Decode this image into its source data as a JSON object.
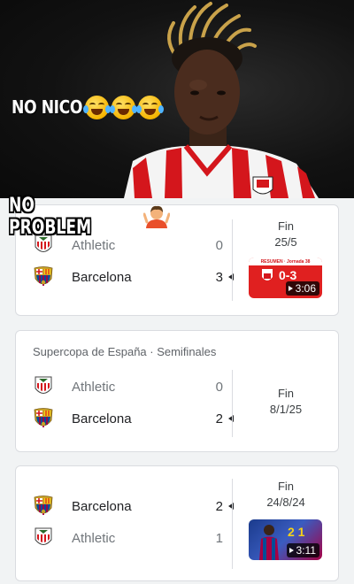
{
  "meme": {
    "top_text": "NO NICO",
    "bottom_text": "NO PROBLEM",
    "top_emojis": [
      "laughing-crying-emoji",
      "laughing-crying-emoji",
      "laughing-crying-emoji"
    ],
    "bottom_emoji": "shrug-emoji"
  },
  "matches": [
    {
      "competition": "",
      "status": "Fin",
      "date": "25/5",
      "teams": [
        {
          "name": "Athletic",
          "score": "0",
          "crest": "athletic-club-crest-icon",
          "winner": false
        },
        {
          "name": "Barcelona",
          "score": "3",
          "crest": "fc-barcelona-crest-icon",
          "winner": true
        }
      ],
      "video": {
        "duration": "3:06",
        "thumb_caption": "RESUMEN · Jornada 38",
        "thumb_score": "0-3"
      }
    },
    {
      "competition": "Supercopa de España · Semifinales",
      "status": "Fin",
      "date": "8/1/25",
      "teams": [
        {
          "name": "Athletic",
          "score": "0",
          "crest": "athletic-club-crest-icon",
          "winner": false
        },
        {
          "name": "Barcelona",
          "score": "2",
          "crest": "fc-barcelona-crest-icon",
          "winner": true
        }
      ]
    },
    {
      "competition": "",
      "status": "Fin",
      "date": "24/8/24",
      "teams": [
        {
          "name": "Barcelona",
          "score": "2",
          "crest": "fc-barcelona-crest-icon",
          "winner": true
        },
        {
          "name": "Athletic",
          "score": "1",
          "crest": "athletic-club-crest-icon",
          "winner": false
        }
      ],
      "video": {
        "duration": "3:11",
        "thumb_score": "2 1"
      }
    }
  ],
  "colors": {
    "athletic_red": "#d4161c",
    "barca_blue": "#004d98",
    "barca_garnet": "#a50044",
    "card_border": "#dadce0",
    "page_bg": "#f1f3f4"
  }
}
